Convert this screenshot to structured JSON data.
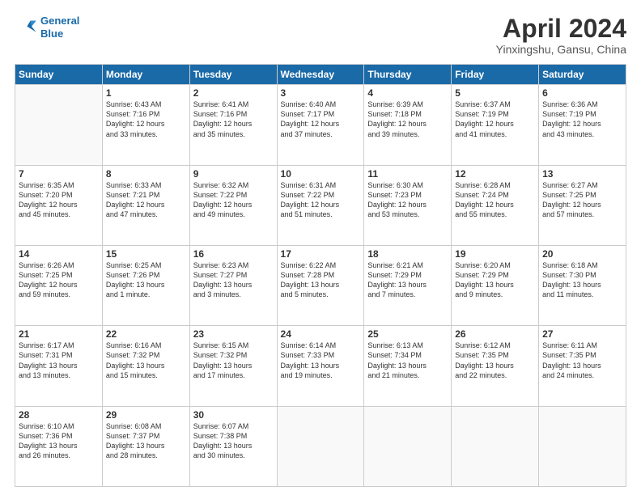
{
  "header": {
    "logo_line1": "General",
    "logo_line2": "Blue",
    "title": "April 2024",
    "subtitle": "Yinxingshu, Gansu, China"
  },
  "columns": [
    "Sunday",
    "Monday",
    "Tuesday",
    "Wednesday",
    "Thursday",
    "Friday",
    "Saturday"
  ],
  "weeks": [
    [
      {
        "day": "",
        "lines": []
      },
      {
        "day": "1",
        "lines": [
          "Sunrise: 6:43 AM",
          "Sunset: 7:16 PM",
          "Daylight: 12 hours",
          "and 33 minutes."
        ]
      },
      {
        "day": "2",
        "lines": [
          "Sunrise: 6:41 AM",
          "Sunset: 7:16 PM",
          "Daylight: 12 hours",
          "and 35 minutes."
        ]
      },
      {
        "day": "3",
        "lines": [
          "Sunrise: 6:40 AM",
          "Sunset: 7:17 PM",
          "Daylight: 12 hours",
          "and 37 minutes."
        ]
      },
      {
        "day": "4",
        "lines": [
          "Sunrise: 6:39 AM",
          "Sunset: 7:18 PM",
          "Daylight: 12 hours",
          "and 39 minutes."
        ]
      },
      {
        "day": "5",
        "lines": [
          "Sunrise: 6:37 AM",
          "Sunset: 7:19 PM",
          "Daylight: 12 hours",
          "and 41 minutes."
        ]
      },
      {
        "day": "6",
        "lines": [
          "Sunrise: 6:36 AM",
          "Sunset: 7:19 PM",
          "Daylight: 12 hours",
          "and 43 minutes."
        ]
      }
    ],
    [
      {
        "day": "7",
        "lines": [
          "Sunrise: 6:35 AM",
          "Sunset: 7:20 PM",
          "Daylight: 12 hours",
          "and 45 minutes."
        ]
      },
      {
        "day": "8",
        "lines": [
          "Sunrise: 6:33 AM",
          "Sunset: 7:21 PM",
          "Daylight: 12 hours",
          "and 47 minutes."
        ]
      },
      {
        "day": "9",
        "lines": [
          "Sunrise: 6:32 AM",
          "Sunset: 7:22 PM",
          "Daylight: 12 hours",
          "and 49 minutes."
        ]
      },
      {
        "day": "10",
        "lines": [
          "Sunrise: 6:31 AM",
          "Sunset: 7:22 PM",
          "Daylight: 12 hours",
          "and 51 minutes."
        ]
      },
      {
        "day": "11",
        "lines": [
          "Sunrise: 6:30 AM",
          "Sunset: 7:23 PM",
          "Daylight: 12 hours",
          "and 53 minutes."
        ]
      },
      {
        "day": "12",
        "lines": [
          "Sunrise: 6:28 AM",
          "Sunset: 7:24 PM",
          "Daylight: 12 hours",
          "and 55 minutes."
        ]
      },
      {
        "day": "13",
        "lines": [
          "Sunrise: 6:27 AM",
          "Sunset: 7:25 PM",
          "Daylight: 12 hours",
          "and 57 minutes."
        ]
      }
    ],
    [
      {
        "day": "14",
        "lines": [
          "Sunrise: 6:26 AM",
          "Sunset: 7:25 PM",
          "Daylight: 12 hours",
          "and 59 minutes."
        ]
      },
      {
        "day": "15",
        "lines": [
          "Sunrise: 6:25 AM",
          "Sunset: 7:26 PM",
          "Daylight: 13 hours",
          "and 1 minute."
        ]
      },
      {
        "day": "16",
        "lines": [
          "Sunrise: 6:23 AM",
          "Sunset: 7:27 PM",
          "Daylight: 13 hours",
          "and 3 minutes."
        ]
      },
      {
        "day": "17",
        "lines": [
          "Sunrise: 6:22 AM",
          "Sunset: 7:28 PM",
          "Daylight: 13 hours",
          "and 5 minutes."
        ]
      },
      {
        "day": "18",
        "lines": [
          "Sunrise: 6:21 AM",
          "Sunset: 7:29 PM",
          "Daylight: 13 hours",
          "and 7 minutes."
        ]
      },
      {
        "day": "19",
        "lines": [
          "Sunrise: 6:20 AM",
          "Sunset: 7:29 PM",
          "Daylight: 13 hours",
          "and 9 minutes."
        ]
      },
      {
        "day": "20",
        "lines": [
          "Sunrise: 6:18 AM",
          "Sunset: 7:30 PM",
          "Daylight: 13 hours",
          "and 11 minutes."
        ]
      }
    ],
    [
      {
        "day": "21",
        "lines": [
          "Sunrise: 6:17 AM",
          "Sunset: 7:31 PM",
          "Daylight: 13 hours",
          "and 13 minutes."
        ]
      },
      {
        "day": "22",
        "lines": [
          "Sunrise: 6:16 AM",
          "Sunset: 7:32 PM",
          "Daylight: 13 hours",
          "and 15 minutes."
        ]
      },
      {
        "day": "23",
        "lines": [
          "Sunrise: 6:15 AM",
          "Sunset: 7:32 PM",
          "Daylight: 13 hours",
          "and 17 minutes."
        ]
      },
      {
        "day": "24",
        "lines": [
          "Sunrise: 6:14 AM",
          "Sunset: 7:33 PM",
          "Daylight: 13 hours",
          "and 19 minutes."
        ]
      },
      {
        "day": "25",
        "lines": [
          "Sunrise: 6:13 AM",
          "Sunset: 7:34 PM",
          "Daylight: 13 hours",
          "and 21 minutes."
        ]
      },
      {
        "day": "26",
        "lines": [
          "Sunrise: 6:12 AM",
          "Sunset: 7:35 PM",
          "Daylight: 13 hours",
          "and 22 minutes."
        ]
      },
      {
        "day": "27",
        "lines": [
          "Sunrise: 6:11 AM",
          "Sunset: 7:35 PM",
          "Daylight: 13 hours",
          "and 24 minutes."
        ]
      }
    ],
    [
      {
        "day": "28",
        "lines": [
          "Sunrise: 6:10 AM",
          "Sunset: 7:36 PM",
          "Daylight: 13 hours",
          "and 26 minutes."
        ]
      },
      {
        "day": "29",
        "lines": [
          "Sunrise: 6:08 AM",
          "Sunset: 7:37 PM",
          "Daylight: 13 hours",
          "and 28 minutes."
        ]
      },
      {
        "day": "30",
        "lines": [
          "Sunrise: 6:07 AM",
          "Sunset: 7:38 PM",
          "Daylight: 13 hours",
          "and 30 minutes."
        ]
      },
      {
        "day": "",
        "lines": []
      },
      {
        "day": "",
        "lines": []
      },
      {
        "day": "",
        "lines": []
      },
      {
        "day": "",
        "lines": []
      }
    ]
  ]
}
